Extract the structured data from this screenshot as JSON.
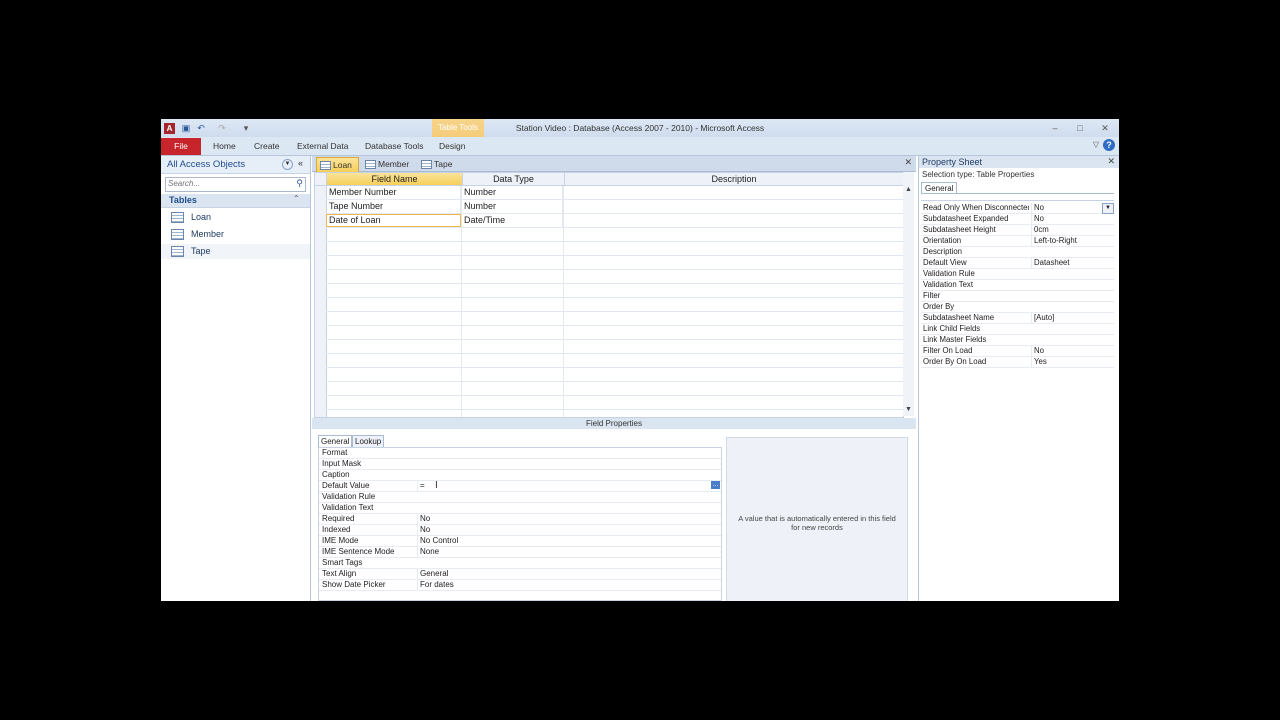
{
  "titlebar": {
    "app_icon": "A",
    "title": "Station Video : Database (Access 2007 - 2010)  -  Microsoft Access",
    "context_tab": "Table Tools",
    "qat": [
      "save-icon",
      "undo-icon",
      "redo-icon",
      "customize-icon"
    ]
  },
  "ribbon": {
    "file": "File",
    "tabs": [
      "Home",
      "Create",
      "External Data",
      "Database Tools",
      "Design"
    ]
  },
  "nav": {
    "header": "All Access Objects",
    "search_placeholder": "Search...",
    "group": "Tables",
    "items": [
      "Loan",
      "Member",
      "Tape"
    ]
  },
  "doc": {
    "tabs": [
      "Loan",
      "Member",
      "Tape"
    ],
    "columns": [
      "Field Name",
      "Data Type",
      "Description"
    ],
    "rows": [
      {
        "field": "Member Number",
        "type": "Number",
        "desc": ""
      },
      {
        "field": "Tape Number",
        "type": "Number",
        "desc": ""
      },
      {
        "field": "Date of Loan",
        "type": "Date/Time",
        "desc": ""
      }
    ]
  },
  "field_properties": {
    "title": "Field Properties",
    "tabs": [
      "General",
      "Lookup"
    ],
    "rows": [
      {
        "k": "Format",
        "v": ""
      },
      {
        "k": "Input Mask",
        "v": ""
      },
      {
        "k": "Caption",
        "v": ""
      },
      {
        "k": "Default Value",
        "v": "="
      },
      {
        "k": "Validation Rule",
        "v": ""
      },
      {
        "k": "Validation Text",
        "v": ""
      },
      {
        "k": "Required",
        "v": "No"
      },
      {
        "k": "Indexed",
        "v": "No"
      },
      {
        "k": "IME Mode",
        "v": "No Control"
      },
      {
        "k": "IME Sentence Mode",
        "v": "None"
      },
      {
        "k": "Smart Tags",
        "v": ""
      },
      {
        "k": "Text Align",
        "v": "General"
      },
      {
        "k": "Show Date Picker",
        "v": "For dates"
      }
    ],
    "help": "A value that is automatically entered in this field for new records"
  },
  "property_sheet": {
    "title": "Property Sheet",
    "selection": "Selection type:  Table Properties",
    "tab": "General",
    "rows": [
      {
        "k": "Read Only When Disconnected",
        "v": "No"
      },
      {
        "k": "Subdatasheet Expanded",
        "v": "No"
      },
      {
        "k": "Subdatasheet Height",
        "v": "0cm"
      },
      {
        "k": "Orientation",
        "v": "Left-to-Right"
      },
      {
        "k": "Description",
        "v": ""
      },
      {
        "k": "Default View",
        "v": "Datasheet"
      },
      {
        "k": "Validation Rule",
        "v": ""
      },
      {
        "k": "Validation Text",
        "v": ""
      },
      {
        "k": "Filter",
        "v": ""
      },
      {
        "k": "Order By",
        "v": ""
      },
      {
        "k": "Subdatasheet Name",
        "v": "[Auto]"
      },
      {
        "k": "Link Child Fields",
        "v": ""
      },
      {
        "k": "Link Master Fields",
        "v": ""
      },
      {
        "k": "Filter On Load",
        "v": "No"
      },
      {
        "k": "Order By On Load",
        "v": "Yes"
      }
    ]
  }
}
